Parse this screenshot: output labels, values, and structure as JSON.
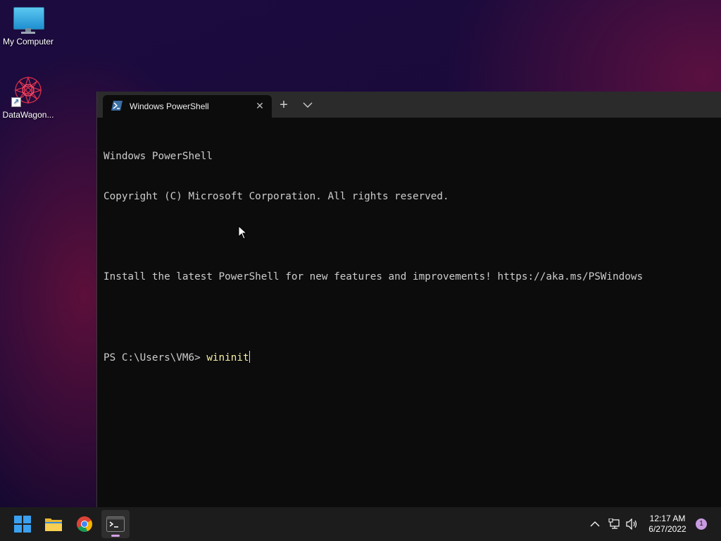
{
  "desktop": {
    "icons": [
      {
        "label": "My Computer"
      },
      {
        "label": "DataWagon..."
      }
    ]
  },
  "terminal": {
    "tab_title": "Windows PowerShell",
    "lines": [
      "Windows PowerShell",
      "Copyright (C) Microsoft Corporation. All rights reserved.",
      "",
      "Install the latest PowerShell for new features and improvements! https://aka.ms/PSWindows",
      ""
    ],
    "prompt": "PS C:\\Users\\VM6> ",
    "command": "wininit"
  },
  "taskbar": {
    "apps": [
      "start",
      "file-explorer",
      "chrome",
      "terminal"
    ],
    "clock": {
      "time": "12:17 AM",
      "date": "6/27/2022"
    },
    "notification_count": "1"
  },
  "colors": {
    "terminal_bg": "#0c0c0c",
    "titlebar_bg": "#2b2b2b",
    "command_color": "#f9f1a5",
    "taskbar_bg": "#1c1c1c"
  }
}
